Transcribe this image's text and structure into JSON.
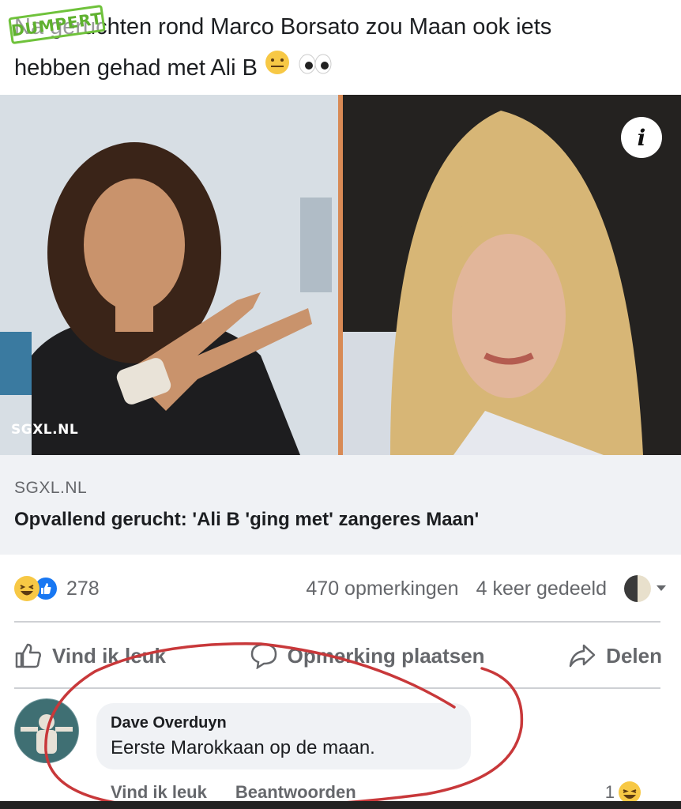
{
  "post": {
    "text_line1": "Na geruchten rond Marco Borsato zou Maan ook iets",
    "text_line2": "hebben gehad met Ali B"
  },
  "watermark": "DUMPERT",
  "media": {
    "left_caption": "SGXL.NL",
    "info_label": "i"
  },
  "link": {
    "domain": "SGXL.NL",
    "title": "Opvallend gerucht: 'Ali B 'ging met' zangeres Maan'"
  },
  "stats": {
    "reactions_count": "278",
    "comments": "470 opmerkingen",
    "shares": "4 keer gedeeld"
  },
  "actions": {
    "like": "Vind ik leuk",
    "comment": "Opmerking plaatsen",
    "share": "Delen"
  },
  "comment": {
    "author": "Dave Overduyn",
    "text": "Eerste Marokkaan op de maan.",
    "like": "Vind ik leuk",
    "reply": "Beantwoorden",
    "reaction_count": "1"
  },
  "colors": {
    "fb_blue": "#1877f2",
    "annotation_red": "#c8383a",
    "watermark_green": "#5fb12f"
  }
}
